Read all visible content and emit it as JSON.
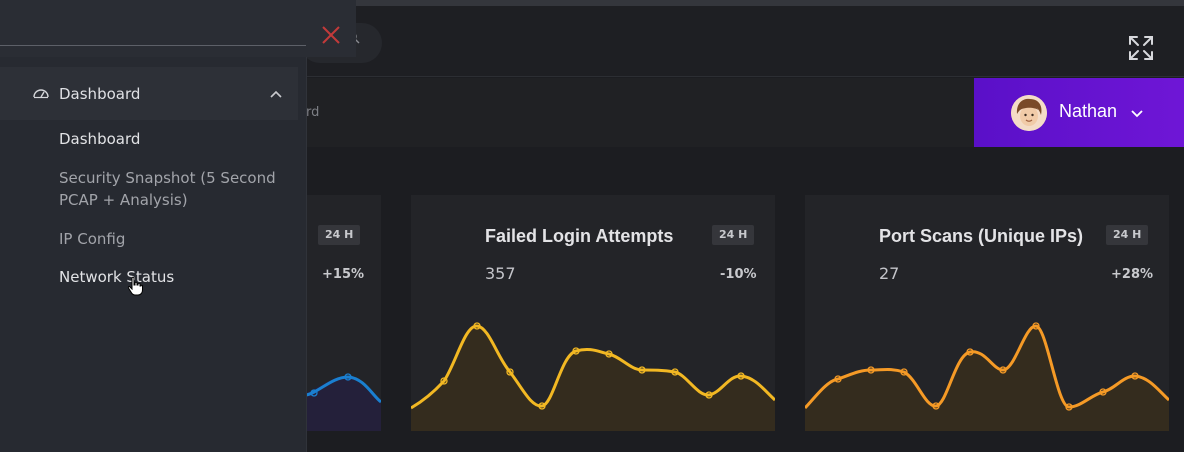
{
  "breadcrumb": {
    "partial_text": "rd"
  },
  "user": {
    "name": "Nathan"
  },
  "sidebar": {
    "parent_label": "Dashboard",
    "items": [
      {
        "label": "Dashboard"
      },
      {
        "label": "Security Snapshot (5 Second"
      },
      {
        "label": "PCAP + Analysis)"
      },
      {
        "label": "IP Config"
      },
      {
        "label": "Network Status"
      }
    ]
  },
  "cards": [
    {
      "title": "",
      "value": "",
      "range": "24 H",
      "delta": "+15%",
      "accent": "#1a7fd0"
    },
    {
      "title": "Failed Login Attempts",
      "value": "357",
      "range": "24 H",
      "delta": "-10%",
      "accent": "#f2b823"
    },
    {
      "title": "Port Scans (Unique IPs)",
      "value": "27",
      "range": "24 H",
      "delta": "+28%",
      "accent": "#f59a26"
    }
  ],
  "colors": {
    "background": "#1c1d21",
    "card": "#232428",
    "sidebar": "#272a31",
    "user_gradient_start": "#5a10c8",
    "user_gradient_end": "#6f16d6",
    "close_icon": "#c23a3a"
  },
  "icons": [
    "search-icon",
    "expand-icon",
    "chevron-down-icon",
    "close-icon",
    "dashboard-gauge-icon",
    "chevron-up-icon",
    "hand-cursor-icon"
  ]
}
